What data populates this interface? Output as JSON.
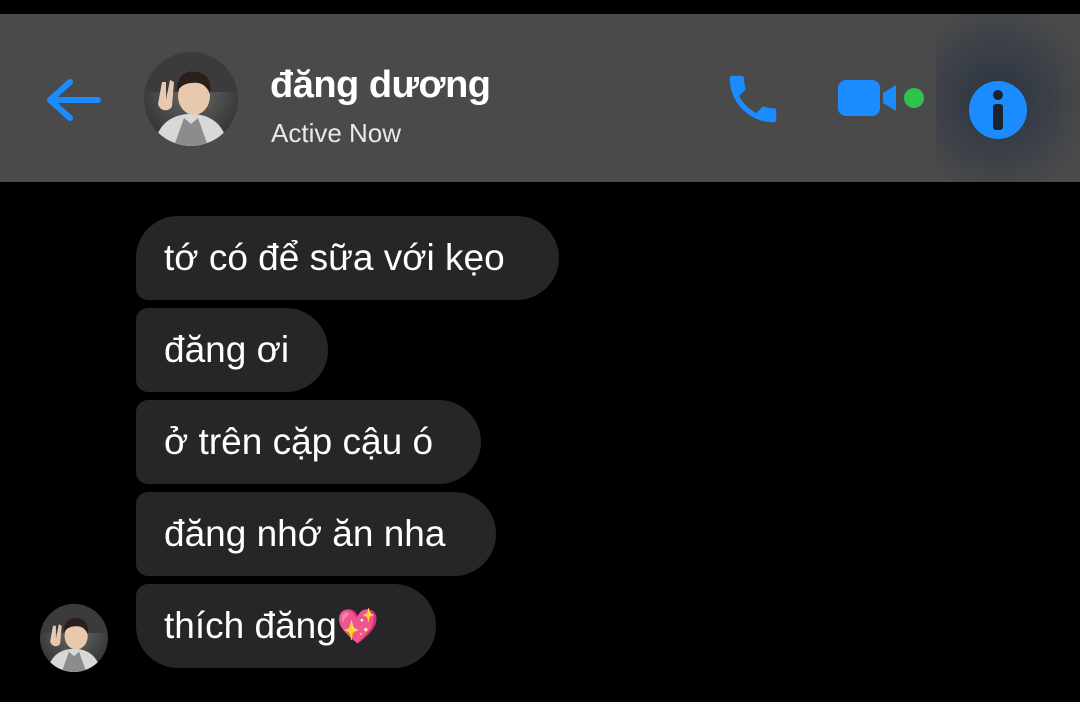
{
  "header": {
    "contact_name": "đăng dương",
    "status": "Active Now",
    "icons": {
      "back": "back-arrow-icon",
      "call": "phone-icon",
      "video": "video-camera-icon",
      "info": "info-icon"
    },
    "colors": {
      "accent": "#1a8cff",
      "online": "#31c24d",
      "header_bg": "#4a4a4a"
    }
  },
  "messages": [
    {
      "text": "tớ có để sữa với kẹo"
    },
    {
      "text": "đăng ơi"
    },
    {
      "text": "ở trên cặp cậu ó"
    },
    {
      "text": "đăng nhớ ăn nha"
    },
    {
      "text": "thích đăng",
      "emoji": "💖"
    }
  ],
  "colors": {
    "background": "#000000",
    "bubble": "#262528",
    "text": "#ffffff"
  }
}
